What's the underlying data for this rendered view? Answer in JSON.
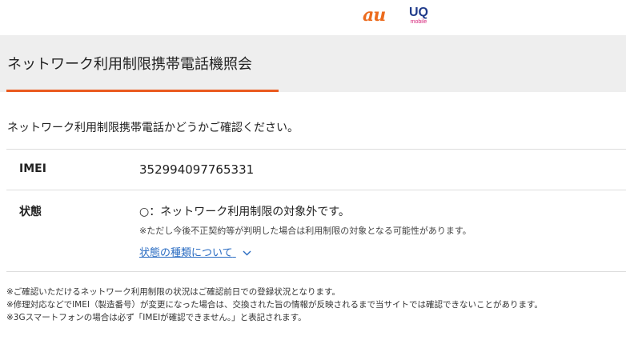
{
  "brand": {
    "au": "au",
    "uq_top": "UQ",
    "uq_bottom": "mobile",
    "colors": {
      "au": "#ec6b1d",
      "uq": "#1f3a8a",
      "mobile": "#d6257a",
      "accent_underline": "#ea5a1f",
      "link": "#2a6cc2"
    }
  },
  "page": {
    "title": "ネットワーク利用制限携帯電話機照会",
    "intro": "ネットワーク利用制限携帯電話かどうかご確認ください。"
  },
  "table": {
    "imei": {
      "label": "IMEI",
      "value": "352994097765331"
    },
    "status": {
      "label": "状態",
      "value": "○：ネットワーク利用制限の対象外です。",
      "note": "※ただし今後不正契約等が判明した場合は利用制限の対象となる可能性があります。",
      "link": "状態の種類について",
      "link_icon": "chevron-down-icon"
    }
  },
  "footnotes": [
    "※ご確認いただけるネットワーク利用制限の状況はご確認前日での登録状況となります。",
    "※修理対応などでIMEI（製造番号）が変更になった場合は、交換された旨の情報が反映されるまで当サイトでは確認できないことがあります。",
    "※3Gスマートフォンの場合は必ず「IMEIが確認できません。」と表記されます。"
  ]
}
